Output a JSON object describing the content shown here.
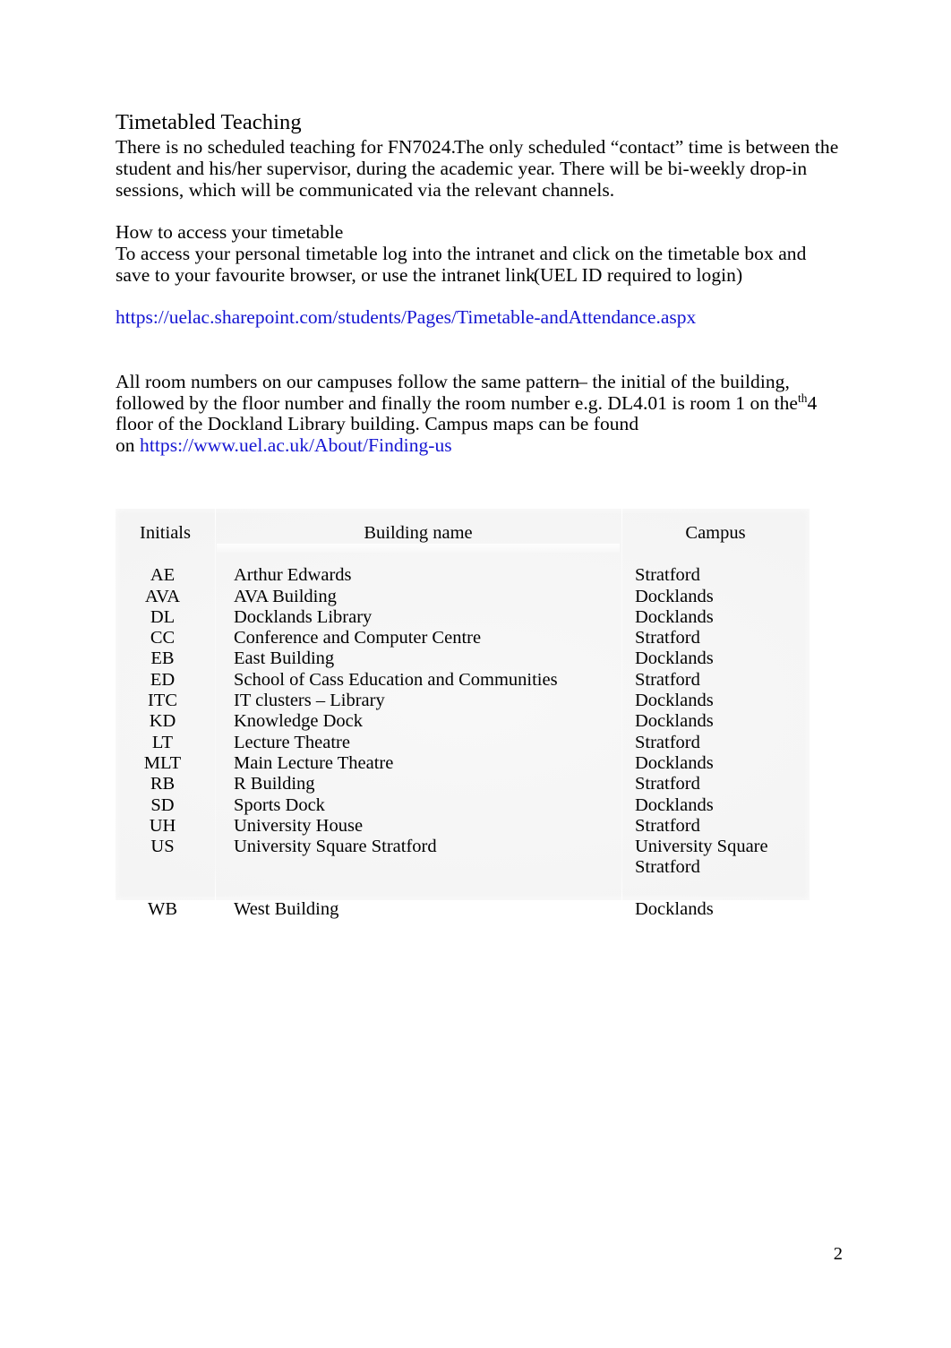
{
  "document": {
    "title": "Timetabled Teaching",
    "page_number": "2"
  },
  "intro": {
    "sentence_1": "There is no scheduled teaching for FN7024.",
    "sentence_2": "The only scheduled “contact” time is between the student and his/her supervisor, during the academic year. There will be bi-weekly drop-in sessions, which will be communicated via the relevant channels."
  },
  "access": {
    "heading": "How to access your timetable",
    "body": "To access your personal timetable log into the intranet and click on the timetable box and save to your favourite browser, or use the intranet link",
    "note": "(UEL ID required to login)",
    "timetable_link": "https://uelac.sharepoint.com/students/Pages/Timetable-andAttendance.aspx"
  },
  "rooms": {
    "text_part_1": "All room numbers on our campuses follow the same pattern",
    "dash": "–",
    "text_part_2": " the initial of the building, followed by the floor number and finally the room number e.g. DL4.01 is room 1 on the",
    "ordinal_number": "4",
    "ordinal_suffix": "th",
    "text_part_3": "floor of the Dockland Library building. Campus maps can be found",
    "on_label": "on",
    "maps_link": "https://www.uel.ac.uk/About/Finding-us"
  },
  "table": {
    "headers": {
      "initials": "Initials",
      "building": "Building name",
      "campus": "Campus"
    },
    "rows": [
      {
        "initials": "AE",
        "building": "Arthur Edwards",
        "campus": "Stratford"
      },
      {
        "initials": "AVA",
        "building": "AVA Building",
        "campus": "Docklands"
      },
      {
        "initials": "DL",
        "building": "Docklands Library",
        "campus": "Docklands"
      },
      {
        "initials": "CC",
        "building": "Conference and Computer Centre",
        "campus": "Stratford"
      },
      {
        "initials": "EB",
        "building": "East Building",
        "campus": "Docklands"
      },
      {
        "initials": "ED",
        "building": "School of Cass Education and Communities",
        "campus": "Stratford"
      },
      {
        "initials": "ITC",
        "building": "IT clusters – Library",
        "campus": "Docklands"
      },
      {
        "initials": "KD",
        "building": "Knowledge Dock",
        "campus": "Docklands"
      },
      {
        "initials": "LT",
        "building": "Lecture Theatre",
        "campus": "Stratford"
      },
      {
        "initials": "MLT",
        "building": "Main Lecture Theatre",
        "campus": "Docklands"
      },
      {
        "initials": "RB",
        "building": "R Building",
        "campus": "Stratford"
      },
      {
        "initials": "SD",
        "building": "Sports Dock",
        "campus": "Docklands"
      },
      {
        "initials": "UH",
        "building": "University House",
        "campus": "Stratford"
      },
      {
        "initials": "US",
        "building": "University Square Stratford",
        "campus": "University Square Stratford"
      },
      {
        "initials": "WB",
        "building": "West Building",
        "campus": "Docklands"
      }
    ]
  },
  "colors": {
    "link": "#1414d2",
    "text": "#000000",
    "page_background": "#ffffff",
    "table_background": "#f4f4f4"
  }
}
